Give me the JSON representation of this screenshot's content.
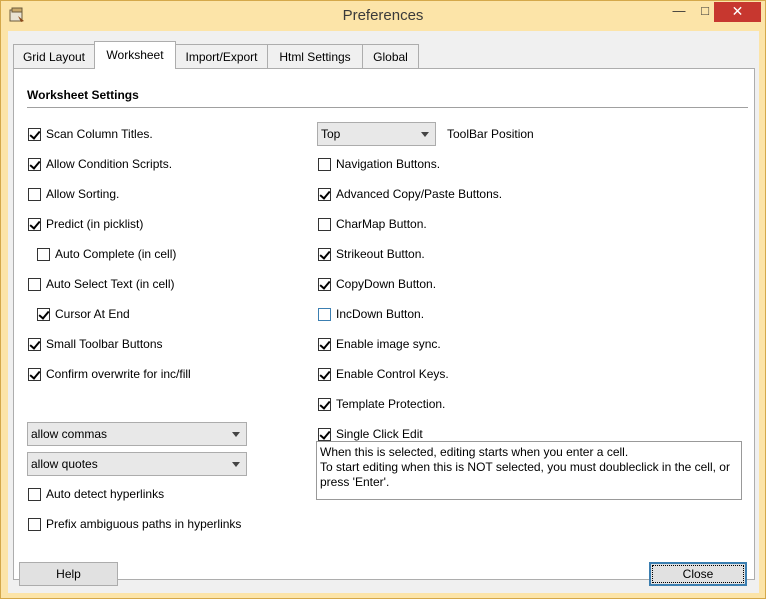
{
  "window": {
    "title": "Preferences"
  },
  "tabs": [
    "Grid Layout",
    "Worksheet",
    "Import/Export",
    "Html Settings",
    "Global"
  ],
  "section_title": "Worksheet Settings",
  "left_checks": [
    {
      "label": "Scan Column Titles.",
      "checked": true
    },
    {
      "label": "Allow Condition Scripts.",
      "checked": true
    },
    {
      "label": "Allow Sorting.",
      "checked": false
    },
    {
      "label": "Predict (in picklist)",
      "checked": true
    },
    {
      "label": "Auto Complete (in cell)",
      "checked": false
    },
    {
      "label": "Auto Select Text (in cell)",
      "checked": false
    },
    {
      "label": "Cursor At End",
      "checked": true
    },
    {
      "label": "Small Toolbar Buttons",
      "checked": true
    },
    {
      "label": "Confirm overwrite for inc/fill",
      "checked": true
    }
  ],
  "combos": {
    "commas": "allow commas",
    "quotes": "allow quotes",
    "toolbar_position": "Top"
  },
  "toolbar_position_label": "ToolBar Position",
  "bottom_left_checks": [
    {
      "label": "Auto detect hyperlinks",
      "checked": false
    },
    {
      "label": "Prefix ambiguous paths in hyperlinks",
      "checked": false
    }
  ],
  "right_checks": [
    {
      "label": "Navigation Buttons.",
      "checked": false
    },
    {
      "label": "Advanced Copy/Paste Buttons.",
      "checked": true
    },
    {
      "label": "CharMap Button.",
      "checked": false
    },
    {
      "label": "Strikeout Button.",
      "checked": true
    },
    {
      "label": "CopyDown Button.",
      "checked": true
    },
    {
      "label": "IncDown Button.",
      "checked": false
    },
    {
      "label": "Enable image sync.",
      "checked": true
    },
    {
      "label": "Enable Control Keys.",
      "checked": true
    },
    {
      "label": "Template Protection.",
      "checked": true
    },
    {
      "label": "Single Click Edit",
      "checked": true
    }
  ],
  "single_click_desc_1": "When this is selected, editing starts when you enter a cell.",
  "single_click_desc_2": "To start editing when this is NOT selected, you must doubleclick in the cell, or press 'Enter'.",
  "buttons": {
    "help": "Help",
    "close": "Close"
  }
}
